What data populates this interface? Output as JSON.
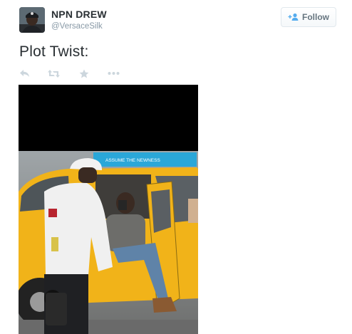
{
  "user": {
    "display_name": "NPN DREW",
    "handle": "@VersaceSilk"
  },
  "follow_button": {
    "label": "Follow",
    "icon": "add-user-icon"
  },
  "tweet": {
    "text": "Plot Twist:"
  },
  "actions": [
    {
      "icon": "reply-icon"
    },
    {
      "icon": "retweet-icon"
    },
    {
      "icon": "favorite-star-icon"
    },
    {
      "icon": "more-dots-icon"
    }
  ],
  "media": {
    "taxi_sign_text": "ASSUME THE NEWNESS",
    "colors": {
      "redacted_bar": "#000000",
      "taxi_yellow": "#f1b319",
      "sign_blue": "#2aa7d8"
    }
  },
  "colors": {
    "name_text": "#292f33",
    "handle_text": "#8899a6",
    "action_icon": "#ccd6dd",
    "follow_text": "#66757f",
    "follow_icon": "#55acee"
  }
}
